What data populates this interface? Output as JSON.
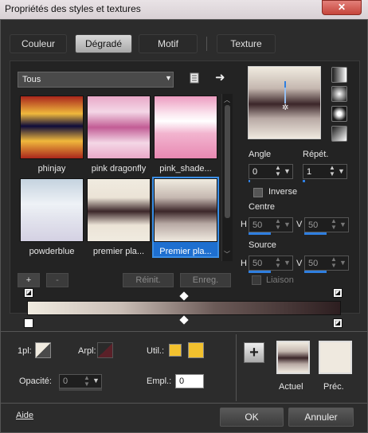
{
  "window": {
    "title": "Propriétés des styles et textures",
    "close": "✕"
  },
  "tabs": [
    {
      "label": "Couleur"
    },
    {
      "label": "Dégradé"
    },
    {
      "label": "Motif"
    },
    {
      "label": "Texture"
    }
  ],
  "category_select": {
    "value": "Tous"
  },
  "presets": [
    {
      "name": "phinjay"
    },
    {
      "name": "pink dragonfly"
    },
    {
      "name": "pink_shade..."
    },
    {
      "name": "powderblue"
    },
    {
      "name": "premier pla..."
    },
    {
      "name": "Premier pla..."
    }
  ],
  "buttons": {
    "add": "+",
    "remove": "-",
    "reinit": "Réinit.",
    "save": "Enreg."
  },
  "angle": {
    "label": "Angle",
    "value": "0",
    "fill_percent": 0
  },
  "repeat": {
    "label": "Répét.",
    "value": "1",
    "fill_percent": 5
  },
  "inverse": {
    "label": "Inverse"
  },
  "centre": {
    "label": "Centre",
    "h_label": "H",
    "v_label": "V",
    "h": "50",
    "v": "50"
  },
  "source": {
    "label": "Source",
    "h_label": "H",
    "v_label": "V",
    "h": "50",
    "v": "50"
  },
  "liaison": {
    "label": "Liaison"
  },
  "editor": {
    "one_pl": "1pl:",
    "arpl": "Arpl:",
    "util": "Util.:",
    "opacity_label": "Opacité:",
    "opacity": "0",
    "empl_label": "Empl.:",
    "empl": "0",
    "util_colors": [
      "#f2c12e",
      "#f2c12e"
    ]
  },
  "swatches": {
    "actual": "Actuel",
    "previous": "Préc."
  },
  "footer": {
    "help": "Aide",
    "ok": "OK",
    "cancel": "Annuler"
  },
  "colors": {
    "accent": "#2f7fe0",
    "selected": "#1e6fd0"
  }
}
